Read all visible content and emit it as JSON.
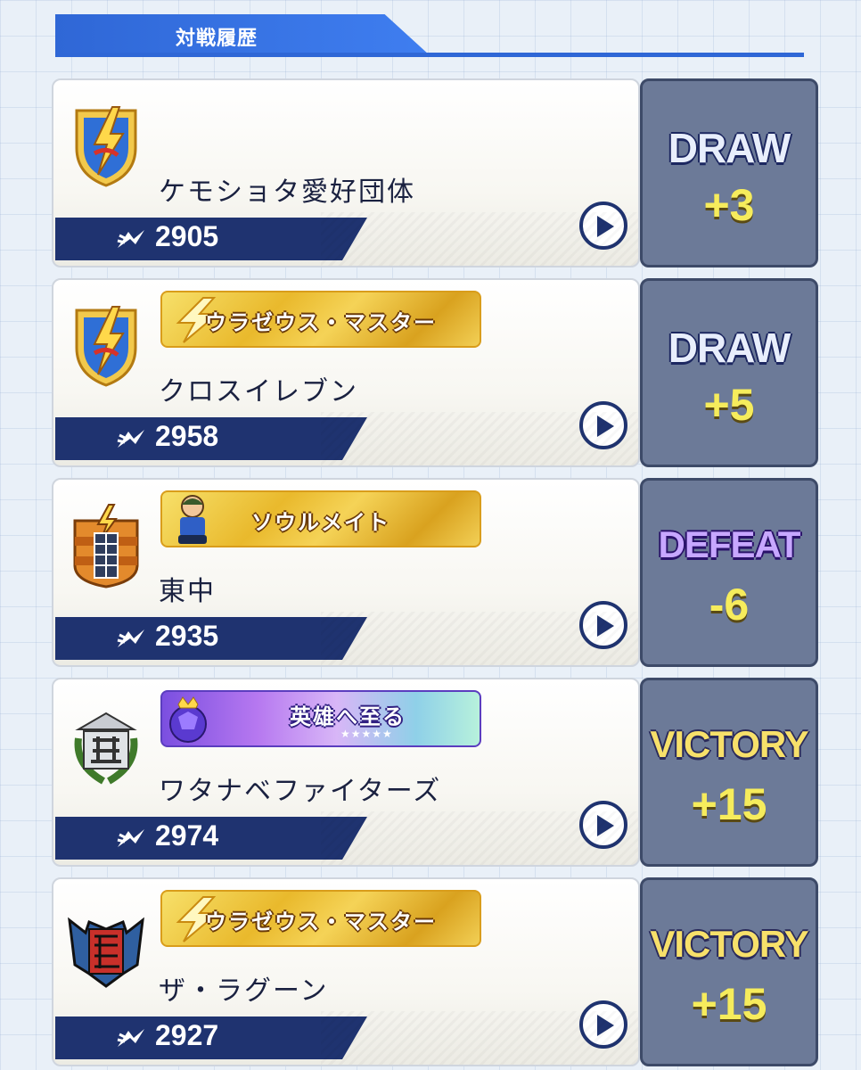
{
  "header": {
    "title": "対戦履歴"
  },
  "matches": [
    {
      "team": "ケモショタ愛好団体",
      "rating": "2905",
      "badge": "",
      "result": "DRAW",
      "points": "+3",
      "result_color": "#e8eefc",
      "emblem": "lightning-shield"
    },
    {
      "team": "クロスイレブン",
      "rating": "2958",
      "badge": "ウラゼウス・マスター",
      "result": "DRAW",
      "points": "+5",
      "result_color": "#e8eefc",
      "emblem": "lightning-shield"
    },
    {
      "team": "東中",
      "rating": "2935",
      "badge": "ソウルメイト",
      "result": "DEFEAT",
      "points": "-6",
      "result_color": "#c7a7ff",
      "emblem": "orange-shield"
    },
    {
      "team": "ワタナベファイターズ",
      "rating": "2974",
      "badge": "英雄へ至る",
      "result": "VICTORY",
      "points": "+15",
      "result_color": "#f7e06a",
      "emblem": "laurel-crest"
    },
    {
      "team": "ザ・ラグーン",
      "rating": "2927",
      "badge": "ウラゼウス・マスター",
      "result": "VICTORY",
      "points": "+15",
      "result_color": "#f7e06a",
      "emblem": "bat-crest"
    }
  ]
}
